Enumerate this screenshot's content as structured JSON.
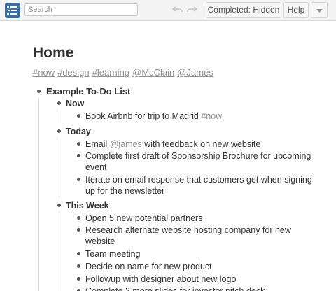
{
  "toolbar": {
    "search_placeholder": "Search",
    "completed_label": "Completed: Hidden",
    "help_label": "Help"
  },
  "page": {
    "title": "Home",
    "tags": [
      "#now",
      "#design",
      "#learning",
      "@McClain",
      "@James"
    ]
  },
  "list": {
    "root": "Example To-Do List",
    "now": {
      "heading": "Now",
      "item1_text": "Book Airbnb for trip to Madrid ",
      "item1_tag": "#now"
    },
    "today": {
      "heading": "Today",
      "item1_pre": "Email ",
      "item1_tag": "@james",
      "item1_post": " with feedback on new website",
      "item2_line1": "Complete first draft of Sponsorship Brochure for upcoming",
      "item2_line2": "event",
      "item3_line1": "Iterate on email response that customers get when signing",
      "item3_line2": "up for the newsletter"
    },
    "this_week": {
      "heading": "This Week",
      "item1": "Open 5 new potential partners",
      "item2_line1": "Research alternate website hosting company for new",
      "item2_line2": "website",
      "item3": "Team meeting",
      "item4": "Decide on name for new product",
      "item5": "Followup with designer about new logo",
      "item6": "Complete 2 more slides for investor pitch deck"
    }
  },
  "colors": {
    "accent": "#3e6f9a",
    "toolbar_bg": "#f4f4f4",
    "text": "#333333",
    "tag": "#8f8f8f"
  },
  "icons": {
    "menu": "list-menu-icon",
    "undo": "undo-icon",
    "redo": "redo-icon",
    "more": "chevron-down-icon"
  }
}
